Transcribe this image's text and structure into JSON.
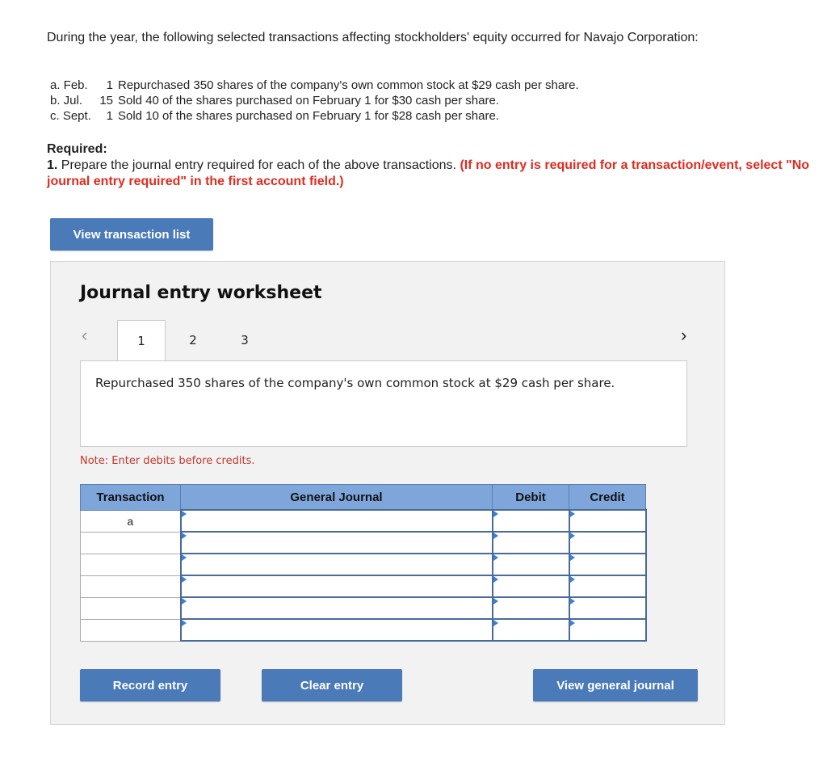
{
  "intro": "During the year, the following selected transactions affecting stockholders' equity occurred for Navajo Corporation:",
  "transactions": [
    {
      "label": "a. Feb.",
      "day": "1",
      "text": "Repurchased 350 shares of the company's own common stock at $29 cash per share."
    },
    {
      "label": "b. Jul.",
      "day": "15",
      "text": "Sold 40 of the shares purchased on February 1 for $30 cash per share."
    },
    {
      "label": "c. Sept.",
      "day": "1",
      "text": "Sold 10 of the shares purchased on February 1 for $28 cash per share."
    }
  ],
  "required": {
    "heading": "Required:",
    "item_number": "1.",
    "text": "Prepare the journal entry required for each of the above transactions.",
    "instruction": "(If no entry is required for a transaction/event, select \"No journal entry required\" in the first account field.)"
  },
  "buttons": {
    "view_transaction_list": "View transaction list",
    "record_entry": "Record entry",
    "clear_entry": "Clear entry",
    "view_general_journal": "View general journal"
  },
  "worksheet": {
    "title": "Journal entry worksheet",
    "tabs": [
      "1",
      "2",
      "3"
    ],
    "active_tab": "1",
    "description": "Repurchased 350 shares of the company's own common stock at $29 cash per share.",
    "note": "Note: Enter debits before credits.",
    "table": {
      "headers": [
        "Transaction",
        "General Journal",
        "Debit",
        "Credit"
      ],
      "rows": [
        {
          "transaction": "a",
          "account": "",
          "debit": "",
          "credit": ""
        },
        {
          "transaction": "",
          "account": "",
          "debit": "",
          "credit": ""
        },
        {
          "transaction": "",
          "account": "",
          "debit": "",
          "credit": ""
        },
        {
          "transaction": "",
          "account": "",
          "debit": "",
          "credit": ""
        },
        {
          "transaction": "",
          "account": "",
          "debit": "",
          "credit": ""
        },
        {
          "transaction": "",
          "account": "",
          "debit": "",
          "credit": ""
        }
      ]
    }
  },
  "icons": {
    "prev": "‹",
    "next": "›"
  },
  "colors": {
    "button": "#4a7ab8",
    "header": "#7ea6db",
    "warning": "#e02b20"
  }
}
